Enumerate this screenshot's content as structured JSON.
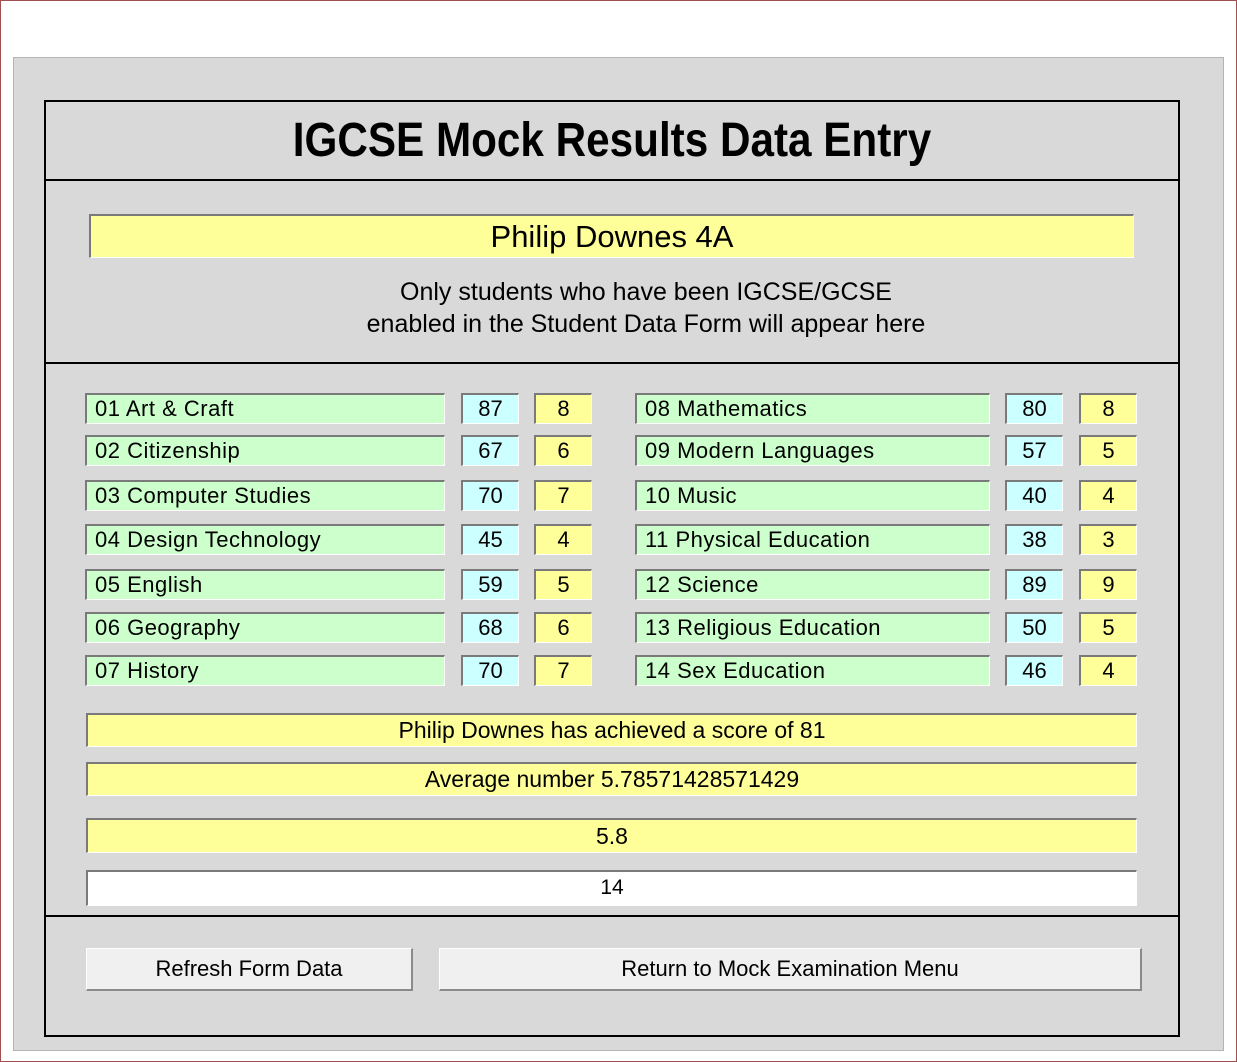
{
  "form": {
    "title": "IGCSE Mock Results Data Entry",
    "student_name": "Philip Downes 4A",
    "note_line1": "Only students who have been IGCSE/GCSE",
    "note_line2": "enabled in the Student Data Form will appear here"
  },
  "subjects_left": [
    {
      "name": "01 Art & Craft",
      "mark": "87",
      "grade": "8"
    },
    {
      "name": "02 Citizenship",
      "mark": "67",
      "grade": "6"
    },
    {
      "name": "03 Computer Studies",
      "mark": "70",
      "grade": "7"
    },
    {
      "name": "04 Design Technology",
      "mark": "45",
      "grade": "4"
    },
    {
      "name": "05 English",
      "mark": "59",
      "grade": "5"
    },
    {
      "name": "06 Geography",
      "mark": "68",
      "grade": "6"
    },
    {
      "name": "07 History",
      "mark": "70",
      "grade": "7"
    }
  ],
  "subjects_right": [
    {
      "name": "08 Mathematics",
      "mark": "80",
      "grade": "8"
    },
    {
      "name": "09 Modern Languages",
      "mark": "57",
      "grade": "5"
    },
    {
      "name": "10 Music",
      "mark": "40",
      "grade": "4"
    },
    {
      "name": "11 Physical Education",
      "mark": "38",
      "grade": "3"
    },
    {
      "name": "12 Science",
      "mark": "89",
      "grade": "9"
    },
    {
      "name": "13 Religious Education",
      "mark": "50",
      "grade": "5"
    },
    {
      "name": "14 Sex Education",
      "mark": "46",
      "grade": "4"
    }
  ],
  "summary": {
    "score_text": "Philip Downes has achieved a score of 81",
    "average_text": "Average number 5.78571428571429",
    "rounded_average": "5.8",
    "count": "14"
  },
  "buttons": {
    "refresh": "Refresh Form Data",
    "return_menu": "Return to Mock Examination Menu"
  },
  "colors": {
    "subject_bg": "#ccffcc",
    "mark_bg": "#ccffff",
    "grade_bg": "#ffff99",
    "form_bg": "#d9d9d9"
  }
}
